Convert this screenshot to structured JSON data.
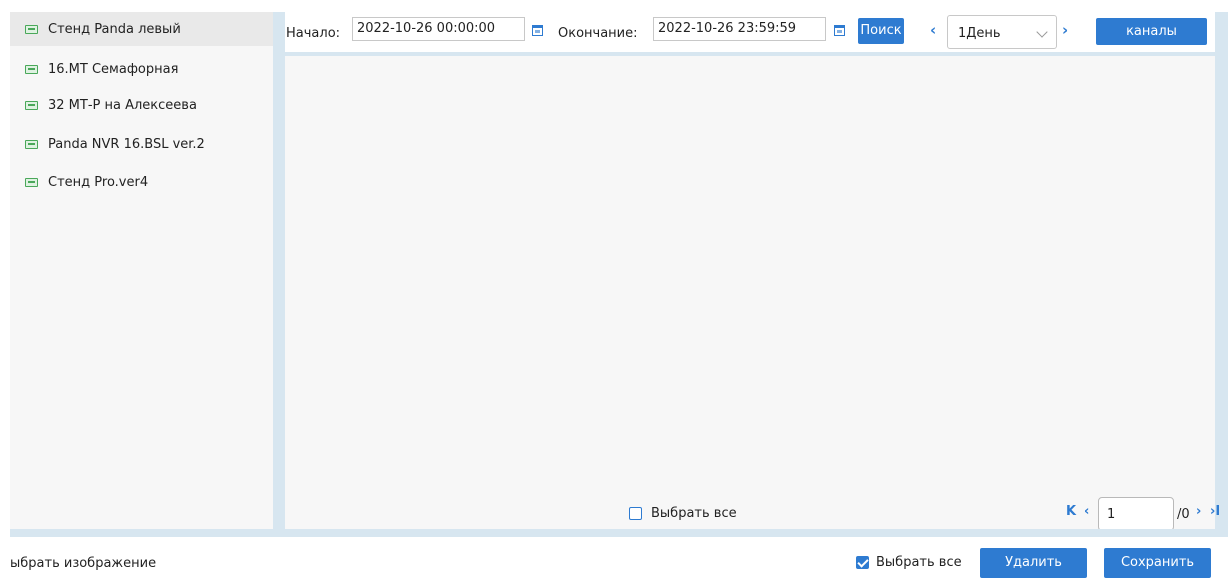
{
  "sidebar": {
    "items": [
      {
        "label": "Стенд Panda левый",
        "icon": "device-icon",
        "active": true
      },
      {
        "label": "16.МТ Семафорная",
        "icon": "device-icon",
        "active": false
      },
      {
        "label": "32 МТ-Р на Алексеева",
        "icon": "device-icon",
        "active": false
      },
      {
        "label": "Panda NVR 16.BSL ver.2",
        "icon": "device-icon",
        "active": false
      },
      {
        "label": "Стенд Pro.ver4",
        "icon": "device-icon",
        "active": false
      }
    ]
  },
  "toolbar": {
    "start_label": "Начало:",
    "start_value": "2022-10-26 00:00:00",
    "end_label": "Окончание:",
    "end_value": "2022-10-26 23:59:59",
    "search_label": "Поиск",
    "period_value": "1День",
    "channels_label": "каналы"
  },
  "content": {
    "select_all_label": "Выбрать все",
    "select_all_checked": false,
    "pagination": {
      "current_page": "1",
      "total": "/0"
    }
  },
  "footer": {
    "choose_image_label": "ыбрать изображение",
    "select_all_label": "Выбрать все",
    "select_all_checked": true,
    "delete_label": "Удалить",
    "save_label": "Сохранить"
  },
  "colors": {
    "accent": "#2e7bd1",
    "panel_bg": "#f7f7f7",
    "frame_bg": "#d7e6f0"
  }
}
